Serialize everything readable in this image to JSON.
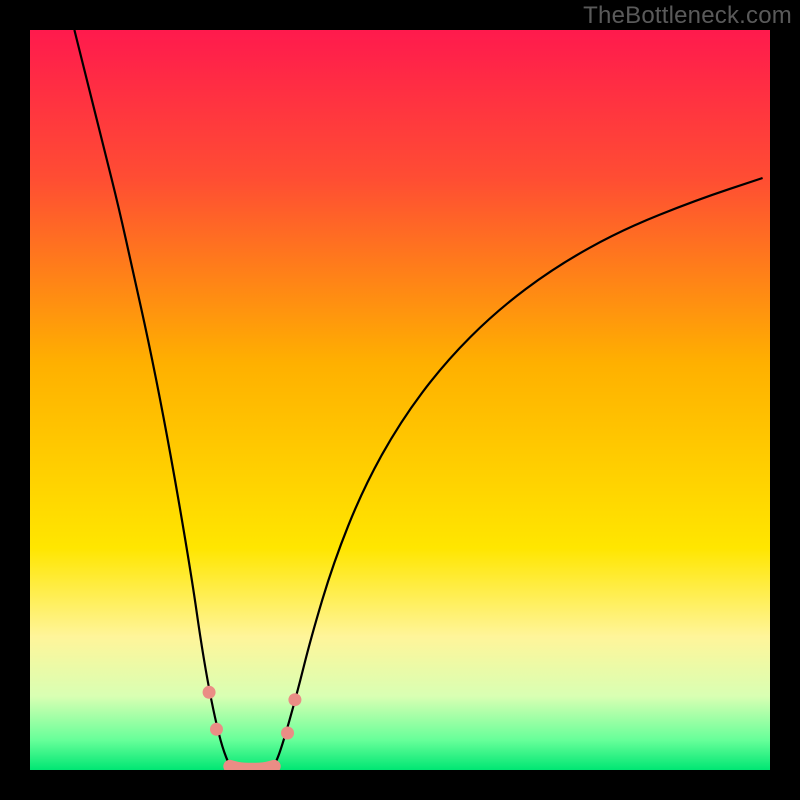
{
  "watermark": "TheBottleneck.com",
  "chart_data": {
    "type": "line",
    "title": "",
    "xlabel": "",
    "ylabel": "",
    "xlim": [
      0,
      100
    ],
    "ylim": [
      0,
      100
    ],
    "grid": false,
    "legend": false,
    "background_gradient": {
      "stops": [
        {
          "offset": 0.0,
          "color": "#ff1a4d"
        },
        {
          "offset": 0.2,
          "color": "#ff4d33"
        },
        {
          "offset": 0.45,
          "color": "#ffb000"
        },
        {
          "offset": 0.7,
          "color": "#ffe600"
        },
        {
          "offset": 0.82,
          "color": "#fff59a"
        },
        {
          "offset": 0.9,
          "color": "#d9ffb3"
        },
        {
          "offset": 0.96,
          "color": "#66ff99"
        },
        {
          "offset": 1.0,
          "color": "#00e673"
        }
      ]
    },
    "series": [
      {
        "name": "left-branch",
        "stroke": "#000000",
        "stroke_width": 2.2,
        "x": [
          6,
          8,
          10,
          12,
          14,
          16,
          18,
          20,
          22,
          23,
          24,
          25,
          26,
          27
        ],
        "y": [
          100,
          92,
          84,
          76,
          67,
          58,
          48,
          37,
          25,
          18,
          12,
          7,
          3,
          0.5
        ]
      },
      {
        "name": "right-branch",
        "stroke": "#000000",
        "stroke_width": 2.2,
        "x": [
          33,
          34,
          36,
          38,
          41,
          45,
          50,
          56,
          63,
          71,
          80,
          90,
          99
        ],
        "y": [
          0.5,
          3,
          10,
          18,
          28,
          38,
          47,
          55,
          62,
          68,
          73,
          77,
          80
        ]
      },
      {
        "name": "bottom-band",
        "stroke": "#ea8d85",
        "stroke_width": 13,
        "linecap": "round",
        "x": [
          27,
          28,
          29,
          30,
          31,
          32,
          33
        ],
        "y": [
          0.5,
          0.2,
          0.1,
          0.1,
          0.1,
          0.2,
          0.5
        ]
      }
    ],
    "markers": [
      {
        "name": "left-dot-upper",
        "x": 24.2,
        "y": 10.5,
        "r": 6.5,
        "fill": "#ea8d85"
      },
      {
        "name": "left-dot-lower",
        "x": 25.2,
        "y": 5.5,
        "r": 6.5,
        "fill": "#ea8d85"
      },
      {
        "name": "right-dot-upper",
        "x": 35.8,
        "y": 9.5,
        "r": 6.5,
        "fill": "#ea8d85"
      },
      {
        "name": "right-dot-lower",
        "x": 34.8,
        "y": 5.0,
        "r": 6.5,
        "fill": "#ea8d85"
      }
    ]
  }
}
